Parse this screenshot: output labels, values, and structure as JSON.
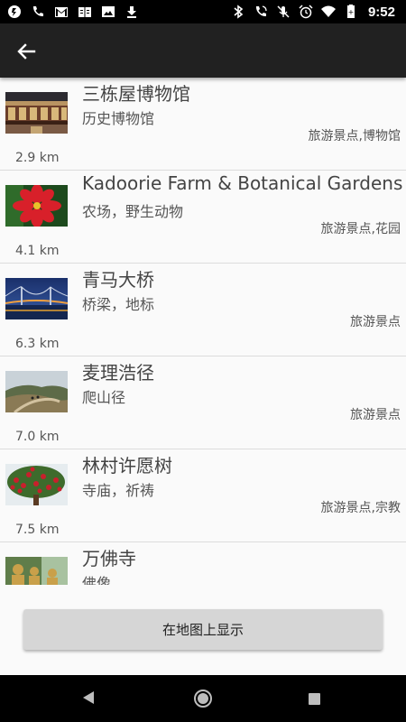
{
  "status_bar": {
    "time": "9:52",
    "left_icons": [
      "app-icon",
      "phone-icon",
      "gmail-icon",
      "book-icon",
      "image-icon",
      "download-icon"
    ],
    "right_icons": [
      "bluetooth-icon",
      "wifi-calling-icon",
      "mic-off-icon",
      "alarm-icon",
      "wifi-icon",
      "battery-icon"
    ]
  },
  "list": {
    "items": [
      {
        "title": "三栋屋博物馆",
        "subtitle": "历史博物馆",
        "category": "旅游景点,博物馆",
        "distance": "2.9 km",
        "thumb": "museum-building"
      },
      {
        "title": "Kadoorie Farm & Botanical Gardens",
        "subtitle": "农场，野生动物",
        "category": "旅游景点,花园",
        "distance": "4.1 km",
        "thumb": "red-flower"
      },
      {
        "title": "青马大桥",
        "subtitle": "桥梁，地标",
        "category": "旅游景点",
        "distance": "6.3 km",
        "thumb": "bridge-night"
      },
      {
        "title": "麦理浩径",
        "subtitle": "爬山径",
        "category": "旅游景点",
        "distance": "7.0 km",
        "thumb": "hiking-trail"
      },
      {
        "title": "林村许愿树",
        "subtitle": "寺庙，祈祷",
        "category": "旅游景点,宗教",
        "distance": "7.5 km",
        "thumb": "wishing-tree"
      },
      {
        "title": "万佛寺",
        "subtitle": "佛像",
        "category": "",
        "distance": "",
        "thumb": "buddha-statues"
      }
    ]
  },
  "map_button": {
    "label": "在地图上显示"
  },
  "colors": {
    "app_bar": "#212121",
    "button": "#d6d6d6",
    "background": "#fafafa"
  }
}
